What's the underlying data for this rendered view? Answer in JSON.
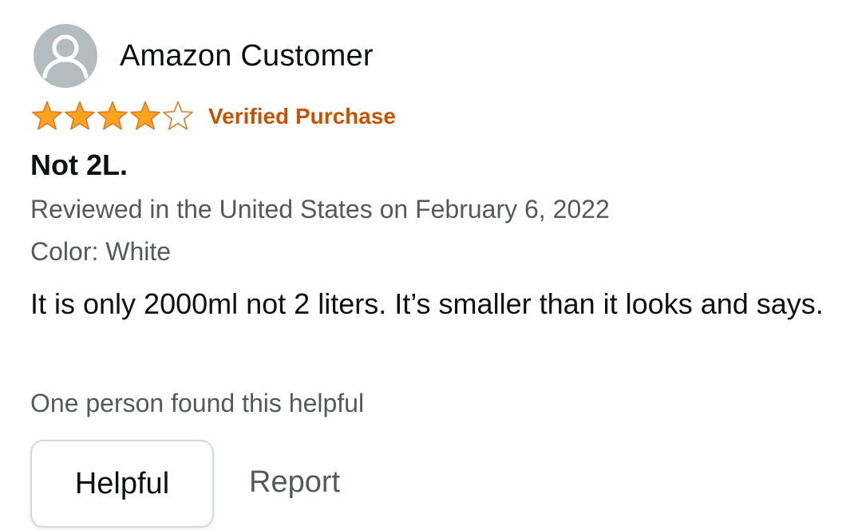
{
  "reviewer": {
    "name": "Amazon Customer",
    "avatar_icon": "user-silhouette-icon",
    "avatar_color": "#b4bcbf"
  },
  "rating": {
    "value": 4,
    "max": 5,
    "star_color": "#ffa41c",
    "star_outline_color": "#de7921",
    "verified_label": "Verified Purchase",
    "verified_color": "#c45500"
  },
  "review": {
    "title": "Not 2L.",
    "date_line": "Reviewed in the United States on February 6, 2022",
    "variant": "Color: White",
    "body": "It is only 2000ml not 2 liters. It’s smaller than it looks and says."
  },
  "feedback": {
    "helpful_count_text": "One person found this helpful",
    "helpful_label": "Helpful",
    "report_label": "Report"
  }
}
